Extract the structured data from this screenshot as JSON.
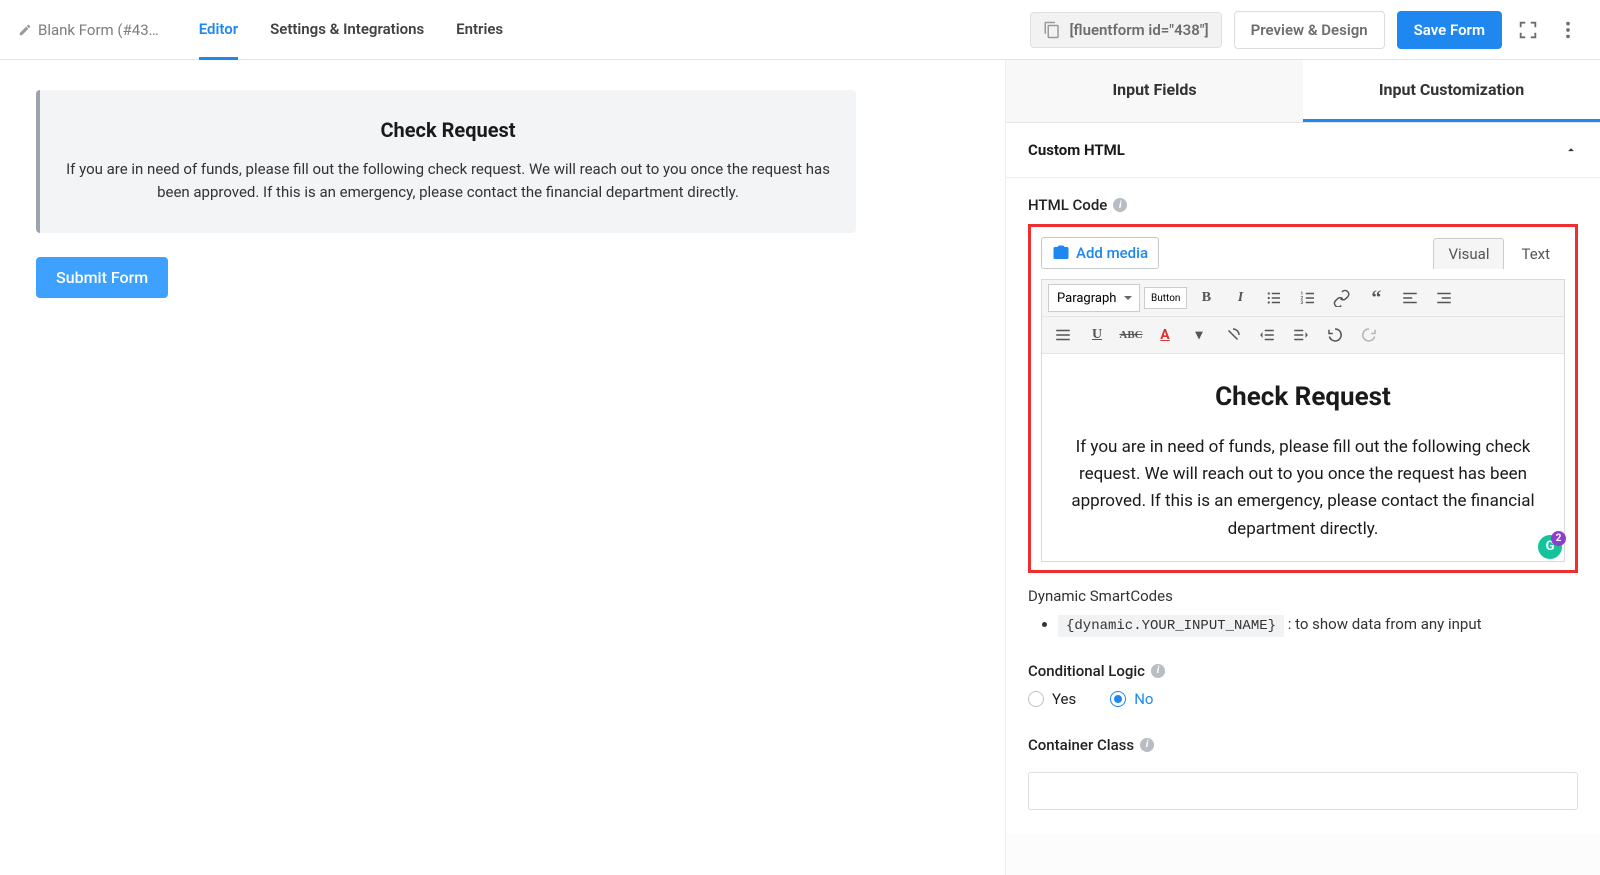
{
  "header": {
    "breadcrumb": "Blank Form (#43…",
    "tabs": {
      "editor": "Editor",
      "settings": "Settings & Integrations",
      "entries": "Entries"
    },
    "shortcode": "[fluentform id=\"438\"]",
    "preview_btn": "Preview & Design",
    "save_btn": "Save Form"
  },
  "canvas": {
    "block_title": "Check Request",
    "block_text": "If you are in need of funds, please fill out the following check request. We will reach out to you once the request has been approved. If this is an emergency, please contact the financial department directly.",
    "submit_label": "Submit Form"
  },
  "sidebar": {
    "tabs": {
      "fields": "Input Fields",
      "custom": "Input Customization"
    },
    "panel_title": "Custom HTML",
    "html_code": {
      "label": "HTML Code",
      "add_media": "Add media",
      "tab_visual": "Visual",
      "tab_text": "Text",
      "format_select": "Paragraph",
      "button_btn": "Button",
      "preview_title": "Check Request",
      "preview_text": "If you are in need of funds, please fill out the following check request. We will reach out to you once the request has been approved. If this is an emergency, please contact the financial department directly.",
      "gram_count": "2"
    },
    "smartcodes": {
      "title": "Dynamic SmartCodes",
      "code": "{dynamic.YOUR_INPUT_NAME}",
      "desc": ": to show data from any input"
    },
    "conditional": {
      "label": "Conditional Logic",
      "yes": "Yes",
      "no": "No"
    },
    "container_class": {
      "label": "Container Class",
      "value": ""
    }
  }
}
